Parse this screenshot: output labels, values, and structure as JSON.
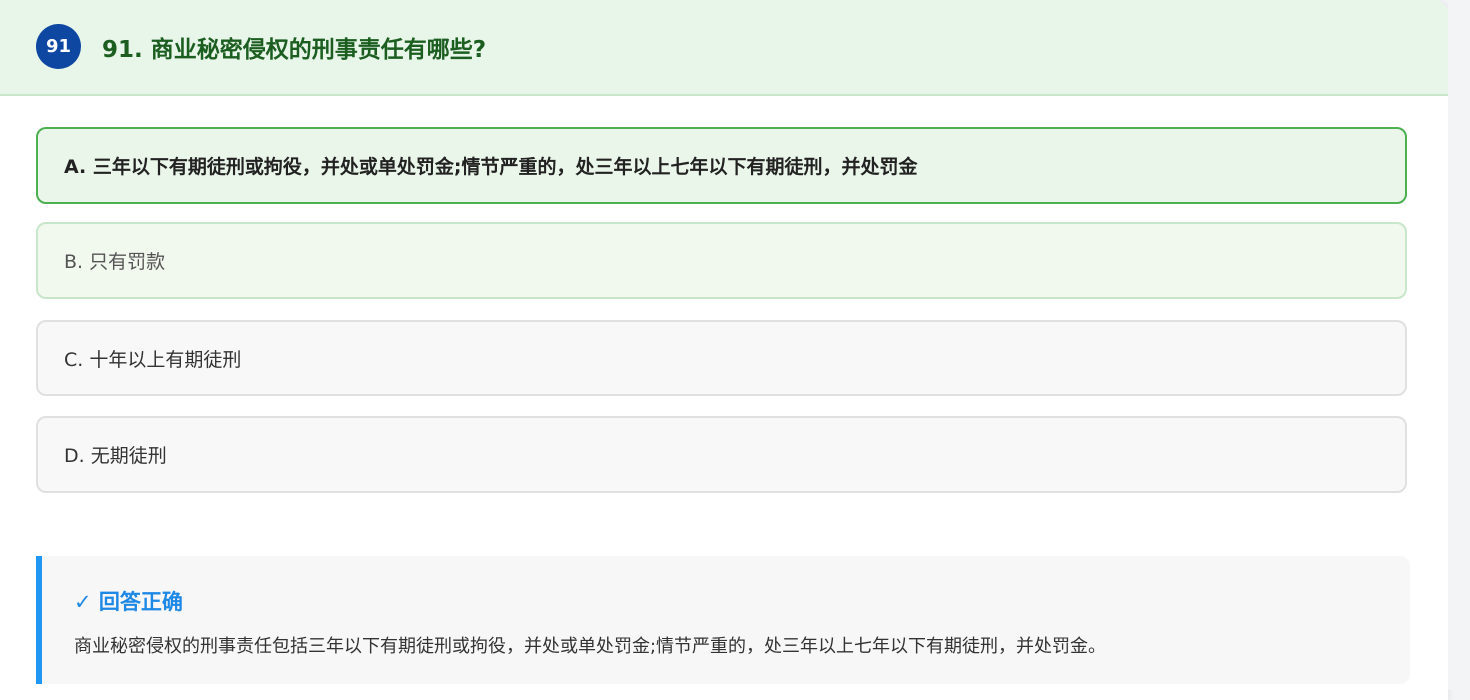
{
  "question": {
    "number": "91",
    "title": "91. 商业秘密侵权的刑事责任有哪些?"
  },
  "options": [
    {
      "label": "A. 三年以下有期徒刑或拘役，并处或单处罚金;情节严重的，处三年以上七年以下有期徒刑，并处罚金",
      "state": "correct-selected"
    },
    {
      "label": "B. 只有罚款",
      "state": "hover"
    },
    {
      "label": "C. 十年以上有期徒刑",
      "state": "normal"
    },
    {
      "label": "D. 无期徒刑",
      "state": "normal"
    }
  ],
  "feedback": {
    "title": "✓ 回答正确",
    "explanation": "商业秘密侵权的刑事责任包括三年以下有期徒刑或拘役，并处或单处罚金;情节严重的，处三年以上七年以下有期徒刑，并处罚金。"
  },
  "colors": {
    "header_bg": "#e8f5e9",
    "title_green": "#1b5e20",
    "badge_blue": "#0d47a1",
    "correct_border": "#4caf50",
    "feedback_accent": "#2196f3"
  }
}
